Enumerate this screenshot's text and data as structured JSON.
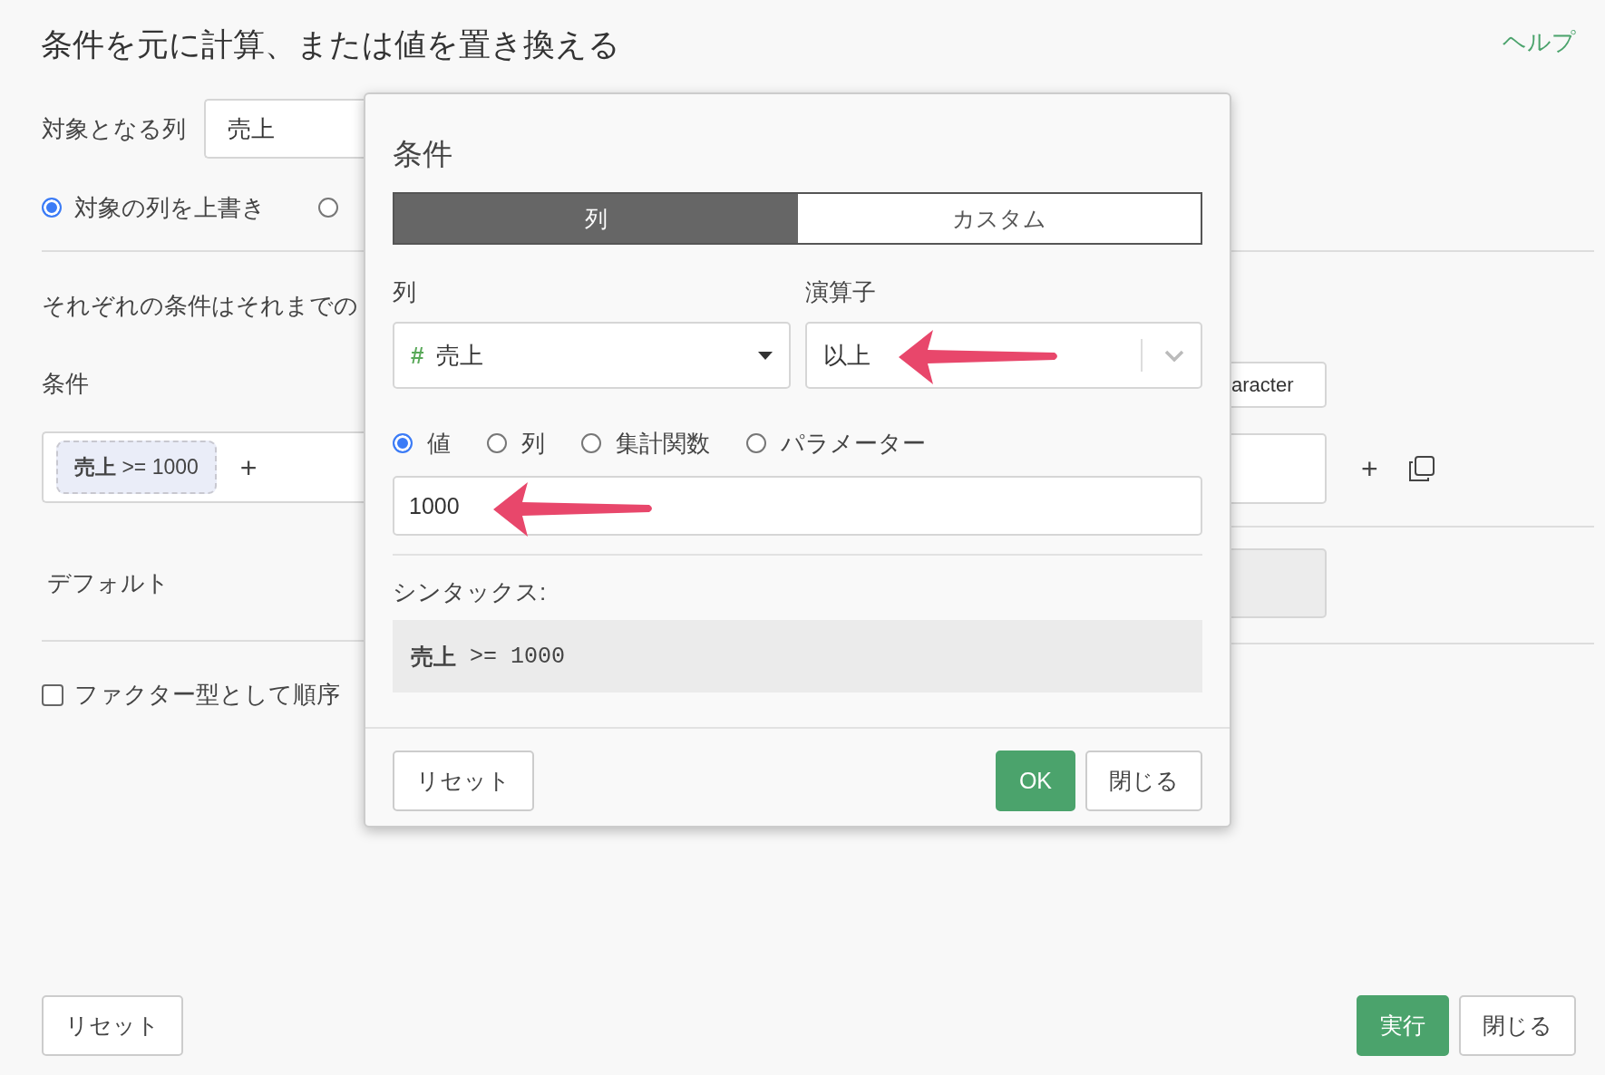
{
  "header": {
    "title": "条件を元に計算、または値を置き換える",
    "help_link": "ヘルプ"
  },
  "form": {
    "target_column": {
      "label": "対象となる列",
      "value": "売上"
    },
    "output_options": [
      {
        "label": "対象の列を上書き",
        "selected": true
      },
      {
        "selected": false
      }
    ],
    "description": "それぞれの条件はそれまでの",
    "conditions_label": "条件",
    "condition_chips": [
      "**売上** >= 1000"
    ],
    "add_condition": "+",
    "default_label": "デフォルト",
    "factor_checkbox": {
      "label": "ファクター型として順序",
      "checked": false
    }
  },
  "right_side": {
    "type_button": "aracter",
    "add_icon": "+"
  },
  "dialog": {
    "title": "条件",
    "tabs": [
      {
        "label": "列",
        "selected": true
      },
      {
        "label": "カスタム",
        "selected": false
      }
    ],
    "column_field": {
      "label": "列",
      "type_icon": "#",
      "value": "売上"
    },
    "operator_field": {
      "label": "演算子",
      "value": "以上"
    },
    "value_types": [
      {
        "label": "値",
        "selected": true
      },
      {
        "label": "列",
        "selected": false
      },
      {
        "label": "集計関数",
        "selected": false
      },
      {
        "label": "パラメーター",
        "selected": false
      }
    ],
    "value_input": "1000",
    "syntax_label": "シンタックス:",
    "syntax": "**売上** >= 1000",
    "buttons": [
      {
        "label": "リセット",
        "kind": "secondary"
      },
      {
        "label": "OK",
        "kind": "primary"
      },
      {
        "label": "閉じる",
        "kind": "secondary"
      }
    ]
  },
  "footer": {
    "buttons": [
      {
        "label": "リセット",
        "kind": "secondary"
      },
      {
        "label": "実行",
        "kind": "primary"
      },
      {
        "label": "閉じる",
        "kind": "secondary"
      }
    ]
  }
}
